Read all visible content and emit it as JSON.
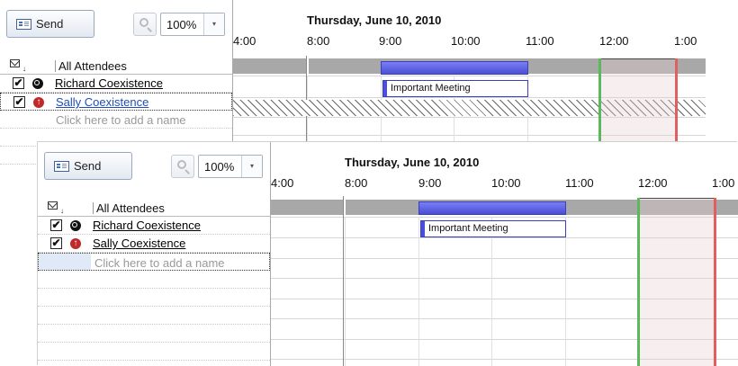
{
  "toolbar": {
    "send_label": "Send",
    "zoom_value": "100%",
    "dropdown_glyph": "▾"
  },
  "header": {
    "date": "Thursday, June 10, 2010",
    "times": [
      "4:00",
      "8:00",
      "9:00",
      "10:00",
      "11:00",
      "12:00",
      "1:00"
    ]
  },
  "attendees_header": {
    "label": "All Attendees"
  },
  "attendees": [
    {
      "name": "Richard Coexistence",
      "checked": "✔",
      "status_icon": "organizer-icon"
    },
    {
      "name": "Sally Coexistence",
      "checked": "✔",
      "status_icon": "required-attendee-icon",
      "status_glyph": "↑"
    }
  ],
  "add_name_placeholder": "Click here to add a name",
  "meeting": {
    "label": "Important Meeting",
    "bar_color": "#4a4ed8"
  },
  "markers": {
    "start_color": "#5bb85b",
    "end_color": "#e06060"
  }
}
